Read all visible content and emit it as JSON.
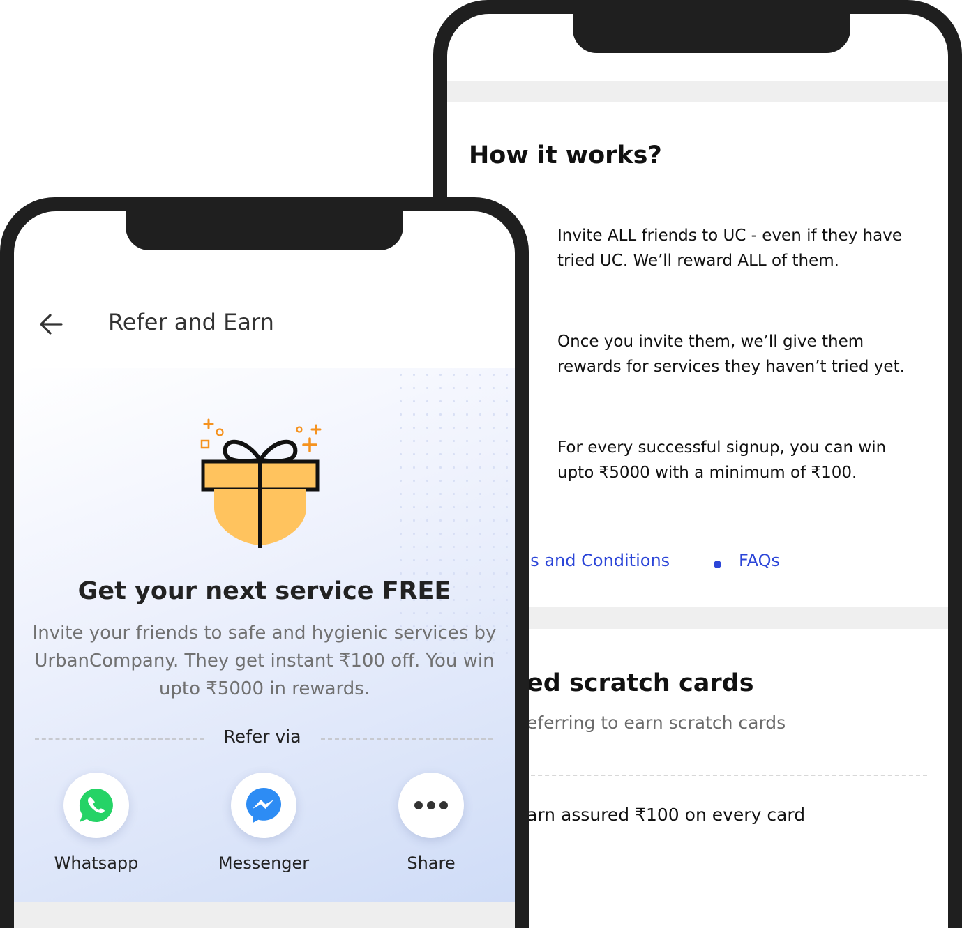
{
  "how_it_works": {
    "title": "How it works?",
    "steps": [
      "Invite ALL friends to UC - even if they have tried UC. We’ll reward ALL of them.",
      "Once you invite them, we’ll give them rewards for services they haven’t tried yet.",
      "For every successful signup, you can win upto ₹5000 with a minimum of ₹100."
    ],
    "links": {
      "terms": "ns and Conditions",
      "faqs": "FAQs"
    }
  },
  "scratch": {
    "title": "ed scratch cards",
    "subtitle": "eferring to earn scratch cards",
    "earn_text": "arn assured ₹100 on every card"
  },
  "header": {
    "title": "Refer and Earn",
    "back_icon": "arrow-left-icon"
  },
  "hero": {
    "title": "Get your next service FREE",
    "description": "Invite your friends to safe and hygienic services by UrbanCompany. They get instant ₹100 off. You win upto ₹5000 in rewards.",
    "gift_icon": "gift-icon"
  },
  "refer": {
    "label": "Refer via",
    "options": [
      {
        "label": "Whatsapp",
        "icon": "whatsapp-icon",
        "color": "#25d366"
      },
      {
        "label": "Messenger",
        "icon": "messenger-icon",
        "color": "#2d8cf4"
      },
      {
        "label": "Share",
        "icon": "more-icon",
        "color": "#333333"
      }
    ]
  },
  "colors": {
    "accent_blue": "#2b45d8",
    "gift_yellow": "#ffc35e",
    "gift_orange": "#f5921e",
    "phone_frame": "#1f1f1f"
  }
}
